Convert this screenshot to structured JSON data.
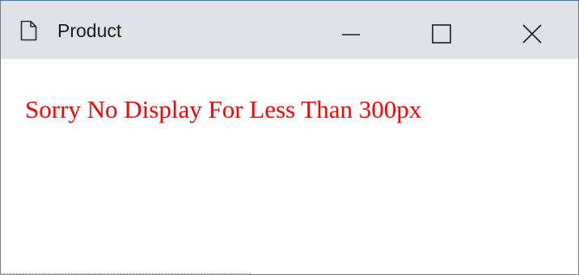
{
  "window": {
    "title": "Product",
    "title_icon": "document-icon",
    "controls": {
      "minimize_icon": "minimize-icon",
      "maximize_icon": "maximize-icon",
      "close_icon": "close-icon"
    },
    "colors": {
      "titlebar_bg": "#dee1e6",
      "border_top": "#2b79d0"
    }
  },
  "content": {
    "message": "Sorry No Display For Less Than 300px",
    "message_color": "#ff0000"
  }
}
